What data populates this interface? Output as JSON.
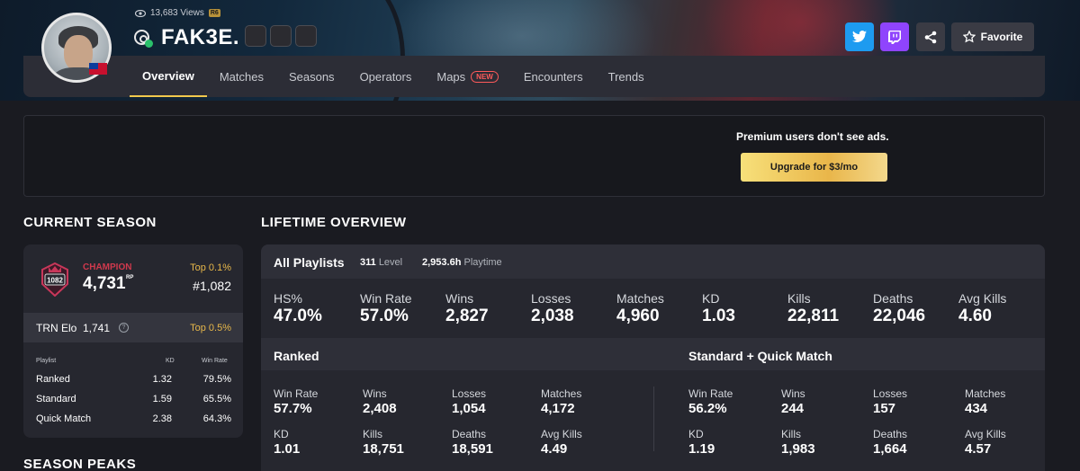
{
  "profile": {
    "views": "13,683 Views",
    "game_badge": "R6",
    "name": "FAK3E.",
    "colors": {
      "accent": "#f2c94c",
      "twitter": "#1d9bf0",
      "twitch": "#8f44fd",
      "champion": "#d0394d"
    }
  },
  "actions": {
    "favorite_label": "Favorite",
    "icons": [
      "twitter-icon",
      "twitch-icon",
      "share-icon",
      "star-icon"
    ]
  },
  "tabs": [
    {
      "label": "Overview",
      "active": true
    },
    {
      "label": "Matches"
    },
    {
      "label": "Seasons"
    },
    {
      "label": "Operators"
    },
    {
      "label": "Maps",
      "badge": "NEW"
    },
    {
      "label": "Encounters"
    },
    {
      "label": "Trends"
    }
  ],
  "ad": {
    "text": "Premium users don't see ads.",
    "button": "Upgrade for $3/mo"
  },
  "current_season": {
    "title": "CURRENT SEASON",
    "rank_name": "CHAMPION",
    "badge_number": "1082",
    "rp": "4,731",
    "rp_unit": "RP",
    "top_pct": "Top 0.1%",
    "position": "#1,082",
    "elo_label": "TRN Elo",
    "elo_value": "1,741",
    "elo_top": "Top 0.5%",
    "table": {
      "headers": [
        "Playlist",
        "KD",
        "Win Rate"
      ],
      "rows": [
        {
          "name": "Ranked",
          "kd": "1.32",
          "wr": "79.5%"
        },
        {
          "name": "Standard",
          "kd": "1.59",
          "wr": "65.5%"
        },
        {
          "name": "Quick Match",
          "kd": "2.38",
          "wr": "64.3%"
        }
      ]
    }
  },
  "season_peaks_title": "SEASON PEAKS",
  "lifetime": {
    "title": "LIFETIME OVERVIEW",
    "playlist": "All Playlists",
    "level_value": "311",
    "level_label": "Level",
    "playtime_value": "2,953.6h",
    "playtime_label": "Playtime",
    "stats": [
      {
        "label": "HS%",
        "value": "47.0%"
      },
      {
        "label": "Win Rate",
        "value": "57.0%"
      },
      {
        "label": "Wins",
        "value": "2,827"
      },
      {
        "label": "Losses",
        "value": "2,038"
      },
      {
        "label": "Matches",
        "value": "4,960"
      },
      {
        "label": "KD",
        "value": "1.03"
      },
      {
        "label": "Kills",
        "value": "22,811"
      },
      {
        "label": "Deaths",
        "value": "22,046"
      },
      {
        "label": "Avg Kills",
        "value": "4.60"
      }
    ],
    "ranked": {
      "title": "Ranked",
      "stats": [
        {
          "label": "Win Rate",
          "value": "57.7%"
        },
        {
          "label": "Wins",
          "value": "2,408"
        },
        {
          "label": "Losses",
          "value": "1,054"
        },
        {
          "label": "Matches",
          "value": "4,172"
        },
        {
          "label": "KD",
          "value": "1.01"
        },
        {
          "label": "Kills",
          "value": "18,751"
        },
        {
          "label": "Deaths",
          "value": "18,591"
        },
        {
          "label": "Avg Kills",
          "value": "4.49"
        }
      ]
    },
    "standard": {
      "title": "Standard + Quick Match",
      "stats": [
        {
          "label": "Win Rate",
          "value": "56.2%"
        },
        {
          "label": "Wins",
          "value": "244"
        },
        {
          "label": "Losses",
          "value": "157"
        },
        {
          "label": "Matches",
          "value": "434"
        },
        {
          "label": "KD",
          "value": "1.19"
        },
        {
          "label": "Kills",
          "value": "1,983"
        },
        {
          "label": "Deaths",
          "value": "1,664"
        },
        {
          "label": "Avg Kills",
          "value": "4.57"
        }
      ]
    }
  }
}
